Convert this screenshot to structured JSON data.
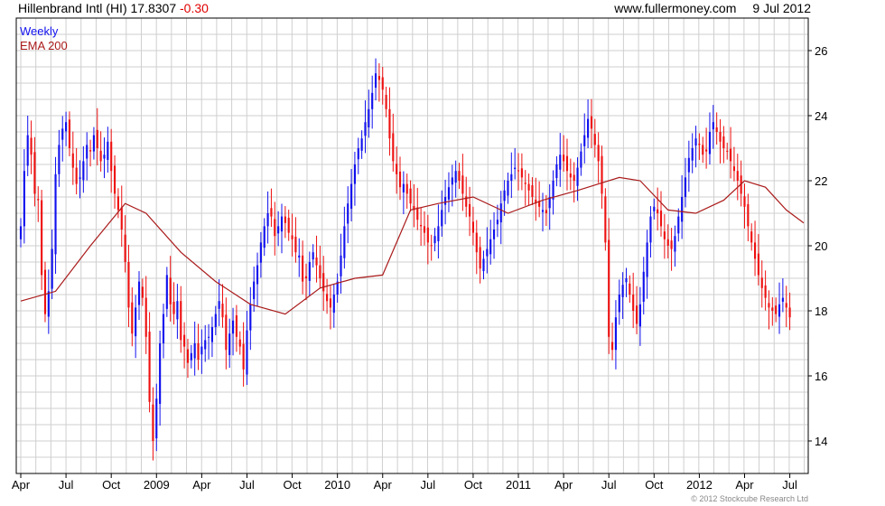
{
  "header": {
    "name": "Hillenbrand Intl (HI)",
    "price": "17.8307",
    "change": "-0.30",
    "site": "www.fullermoney.com",
    "date": "9 Jul 2012"
  },
  "legend": {
    "weekly": "Weekly",
    "ema": "EMA 200"
  },
  "footer": {
    "copyright": "© 2012 Stockcube Research Ltd"
  },
  "colors": {
    "up": "#1010ee",
    "down": "#ee1010",
    "ema": "#aa1a1a",
    "grid": "#cfcfcf",
    "border": "#000000"
  },
  "chart_data": {
    "type": "candlestick",
    "ylim": [
      13,
      27
    ],
    "yticks": [
      14,
      16,
      18,
      20,
      22,
      24,
      26
    ],
    "x_ticks": [
      "Apr",
      "Jul",
      "Oct",
      "2009",
      "Apr",
      "Jul",
      "Oct",
      "2010",
      "Apr",
      "Jul",
      "Oct",
      "2011",
      "Apr",
      "Jul",
      "Oct",
      "2012",
      "Apr",
      "Jul"
    ],
    "x_tick_weeks": [
      0,
      13,
      26,
      39,
      52,
      65,
      78,
      91,
      104,
      117,
      130,
      143,
      156,
      169,
      182,
      195,
      208,
      221
    ],
    "n_weeks": 226,
    "series": [
      {
        "name": "Weekly",
        "kind": "candles",
        "closes": [
          20.6,
          22.3,
          23.4,
          22.8,
          21.6,
          21.4,
          19.1,
          17.9,
          18.6,
          19.9,
          22.2,
          23.1,
          23.6,
          23.8,
          23.0,
          22.4,
          21.9,
          22.1,
          22.6,
          23.1,
          22.9,
          23.4,
          23.0,
          22.6,
          22.8,
          23.2,
          22.3,
          21.6,
          21.1,
          20.5,
          19.5,
          18.1,
          17.3,
          18.1,
          18.9,
          18.4,
          17.2,
          15.2,
          14.0,
          15.3,
          17.0,
          17.9,
          19.1,
          18.2,
          17.9,
          18.3,
          17.1,
          16.9,
          16.4,
          16.7,
          17.0,
          16.5,
          16.9,
          17.1,
          17.2,
          17.5,
          17.9,
          18.3,
          17.8,
          16.8,
          17.3,
          17.7,
          17.2,
          16.9,
          16.2,
          17.4,
          18.2,
          18.9,
          19.4,
          20.1,
          20.6,
          21.0,
          20.9,
          20.3,
          20.6,
          20.9,
          20.7,
          20.4,
          20.2,
          19.8,
          19.7,
          18.9,
          19.0,
          19.5,
          19.8,
          19.4,
          19.0,
          18.6,
          18.3,
          18.1,
          18.5,
          18.9,
          19.7,
          20.6,
          21.3,
          21.9,
          22.5,
          23.0,
          23.3,
          23.8,
          24.2,
          24.7,
          25.3,
          25.1,
          24.8,
          24.2,
          23.3,
          22.6,
          22.2,
          21.8,
          21.9,
          21.6,
          21.3,
          21.1,
          20.8,
          20.6,
          20.4,
          20.1,
          20.0,
          20.3,
          20.6,
          21.1,
          21.5,
          21.8,
          22.1,
          22.3,
          22.0,
          21.6,
          21.2,
          20.9,
          20.4,
          19.8,
          19.3,
          19.6,
          19.9,
          20.2,
          20.5,
          20.8,
          21.3,
          21.7,
          22.0,
          22.2,
          22.4,
          22.3,
          22.1,
          21.9,
          21.7,
          21.5,
          21.3,
          21.2,
          21.1,
          21.0,
          21.5,
          22.0,
          22.5,
          22.8,
          22.6,
          22.3,
          22.1,
          22.0,
          22.4,
          22.9,
          23.4,
          23.9,
          23.6,
          23.1,
          22.6,
          21.6,
          20.1,
          17.2,
          16.8,
          17.8,
          18.5,
          18.8,
          19.0,
          18.5,
          18.0,
          17.6,
          18.2,
          19.2,
          20.1,
          20.9,
          21.2,
          21.0,
          20.6,
          20.2,
          20.0,
          19.9,
          20.3,
          20.9,
          21.5,
          22.1,
          22.7,
          23.0,
          23.3,
          23.1,
          22.8,
          22.9,
          23.5,
          23.8,
          23.5,
          23.2,
          23.0,
          22.9,
          22.6,
          22.3,
          22.0,
          21.6,
          21.2,
          20.6,
          20.1,
          19.6,
          19.1,
          18.7,
          18.4,
          18.1,
          18.0,
          17.9,
          18.2,
          18.4,
          18.1,
          17.8
        ]
      },
      {
        "name": "EMA 200",
        "kind": "line",
        "points": [
          [
            0,
            18.3
          ],
          [
            10,
            18.6
          ],
          [
            20,
            20.0
          ],
          [
            30,
            21.3
          ],
          [
            36,
            21.0
          ],
          [
            46,
            19.8
          ],
          [
            56,
            18.9
          ],
          [
            66,
            18.2
          ],
          [
            76,
            17.9
          ],
          [
            86,
            18.7
          ],
          [
            96,
            19.0
          ],
          [
            104,
            19.1
          ],
          [
            112,
            21.1
          ],
          [
            120,
            21.3
          ],
          [
            130,
            21.5
          ],
          [
            140,
            21.0
          ],
          [
            150,
            21.4
          ],
          [
            160,
            21.7
          ],
          [
            166,
            21.9
          ],
          [
            172,
            22.1
          ],
          [
            178,
            22.0
          ],
          [
            186,
            21.1
          ],
          [
            194,
            21.0
          ],
          [
            202,
            21.4
          ],
          [
            208,
            22.0
          ],
          [
            214,
            21.8
          ],
          [
            220,
            21.1
          ],
          [
            225,
            20.7
          ]
        ]
      }
    ]
  }
}
